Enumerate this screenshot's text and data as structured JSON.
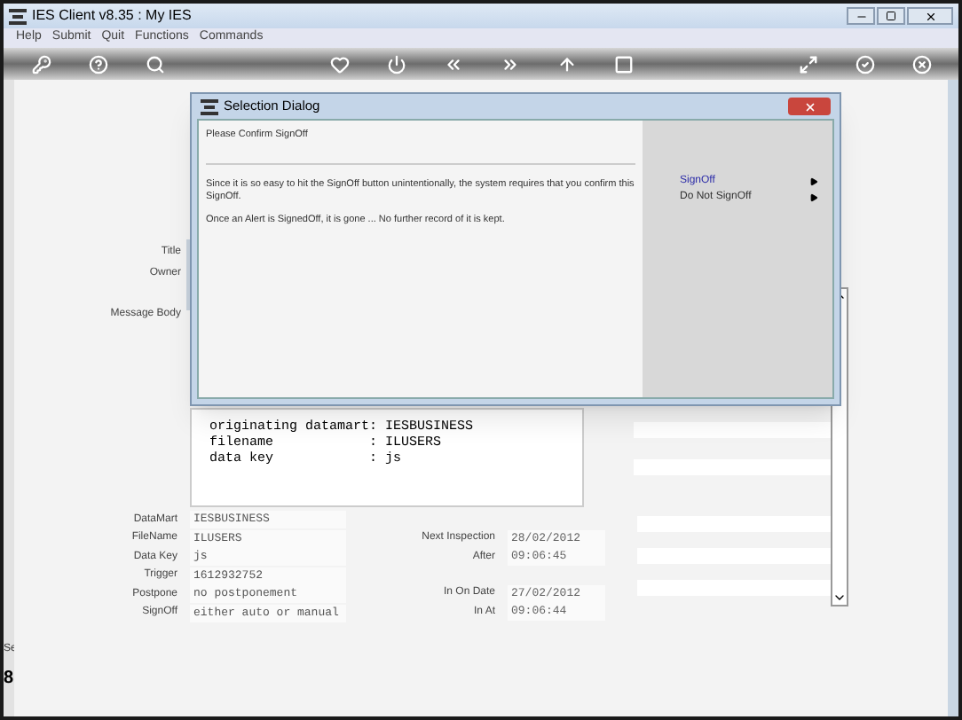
{
  "window": {
    "title": "IES Client v8.35 : My IES"
  },
  "menu": [
    "Help",
    "Submit",
    "Quit",
    "Functions",
    "Commands"
  ],
  "form_labels": [
    "Title",
    "Owner",
    "Message Body"
  ],
  "text_area": [
    "originating datamart: IESBUSINESS",
    "filename            : ILUSERS",
    "data key            : js"
  ],
  "fields": [
    {
      "label": "DataMart",
      "value": "IESBUSINESS"
    },
    {
      "label": "FileName",
      "value": "ILUSERS"
    },
    {
      "label": "Data Key",
      "value": "js"
    },
    {
      "label": "Trigger",
      "value": "1612932752"
    },
    {
      "label": "Postpone",
      "value": "no postponement"
    },
    {
      "label": "SignOff",
      "value": "either auto or manual"
    }
  ],
  "right_fields": [
    {
      "label": "Next Inspection",
      "value": "28/02/2012"
    },
    {
      "label": "After",
      "value": "09:06:45"
    },
    {
      "label": "In On Date",
      "value": "27/02/2012"
    },
    {
      "label": "In At",
      "value": "09:06:44"
    }
  ],
  "left_strip": [
    "Se",
    "8"
  ],
  "dialog": {
    "title": "Selection Dialog",
    "heading": "Please Confirm SignOff",
    "paragraphs": [
      "Since it is so easy to hit the SignOff button unintentionally, the system requires that you confirm this SignOff.",
      "Once an Alert is SignedOff, it is gone ... No further record of it is kept."
    ],
    "options": [
      {
        "label": "SignOff",
        "selected": true
      },
      {
        "label": "Do Not SignOff",
        "selected": false
      }
    ]
  }
}
